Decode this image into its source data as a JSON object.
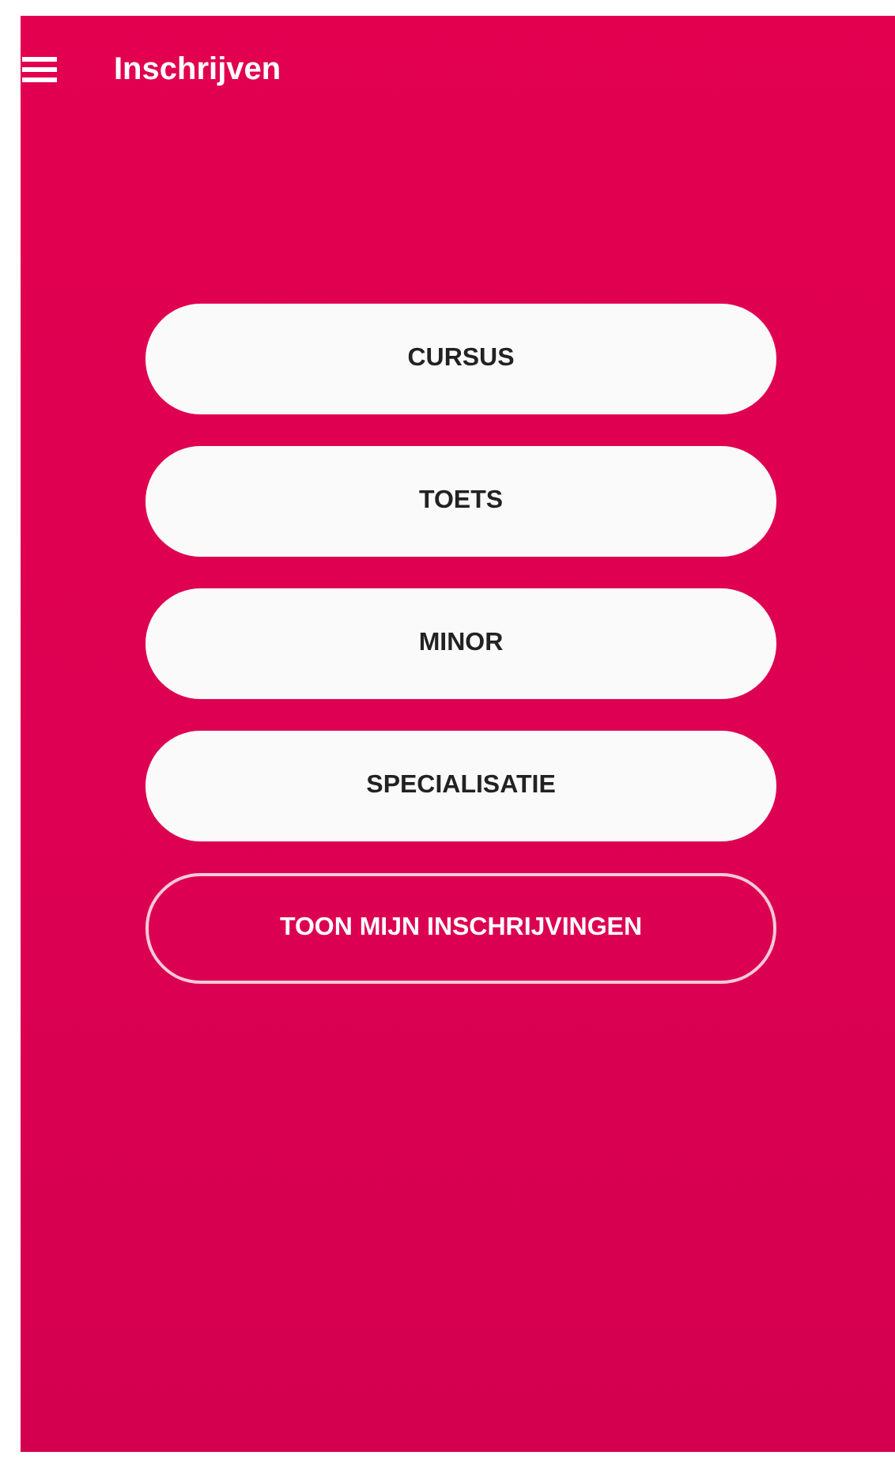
{
  "app_bar": {
    "title": "Inschrijven"
  },
  "buttons": [
    {
      "label": "CURSUS",
      "kind": "filled"
    },
    {
      "label": "TOETS",
      "kind": "filled"
    },
    {
      "label": "MINOR",
      "kind": "filled"
    },
    {
      "label": "SPECIALISATIE",
      "kind": "filled"
    },
    {
      "label": "TOON MIJN INSCHRIJVINGEN",
      "kind": "outline"
    }
  ]
}
